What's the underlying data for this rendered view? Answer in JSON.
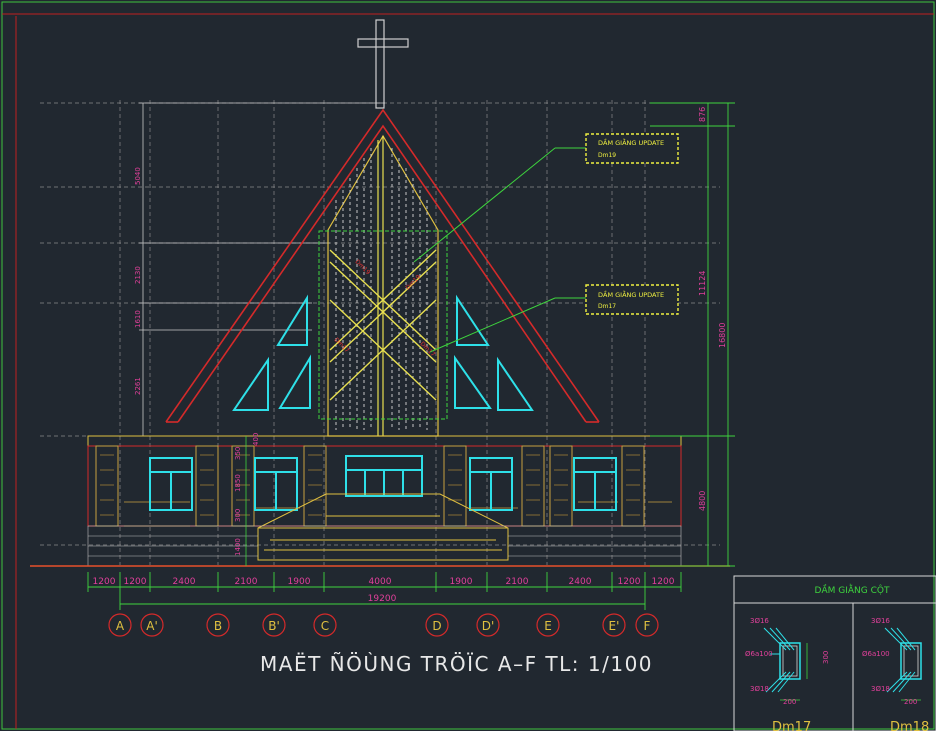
{
  "drawing": {
    "title": "MAËT ÑÖÙNG TRÖÏC A–F TL: 1/100",
    "callout_1_line1": "DẦM GIẰNG UPDATE",
    "callout_1_line2": "Dm19",
    "callout_2_line1": "DẦM GIẰNG UPDATE",
    "callout_2_line2": "Dm17"
  },
  "dimensions": {
    "bottom_segments": [
      "1200",
      "1200",
      "2400",
      "2100",
      "1900",
      "4000",
      "1900",
      "2100",
      "2400",
      "1200",
      "1200"
    ],
    "bottom_total": "19200",
    "right_top": "876",
    "right_roof": "11124",
    "right_wall": "4800",
    "right_total": "16800",
    "left_roof": [
      "5040",
      "2130",
      "1610",
      "2261"
    ],
    "left_wall": [
      "400",
      "350",
      "1850",
      "300",
      "1400"
    ]
  },
  "axes": {
    "labels": [
      "A",
      "A'",
      "B",
      "B'",
      "C",
      "D",
      "D'",
      "E",
      "E'",
      "F"
    ]
  },
  "beam_panel": {
    "title": "DẦM GIẰNG CỘT",
    "left": {
      "top_bar": "3Ø16",
      "stirrup": "Ø6a100",
      "bottom_bar": "3Ø18",
      "width": "200",
      "height": "300",
      "name": "Dm17"
    },
    "right": {
      "top_bar": "3Ø16",
      "stirrup": "Ø6a100",
      "bottom_bar": "3Ø18",
      "width": "200",
      "name": "Dm18"
    }
  }
}
